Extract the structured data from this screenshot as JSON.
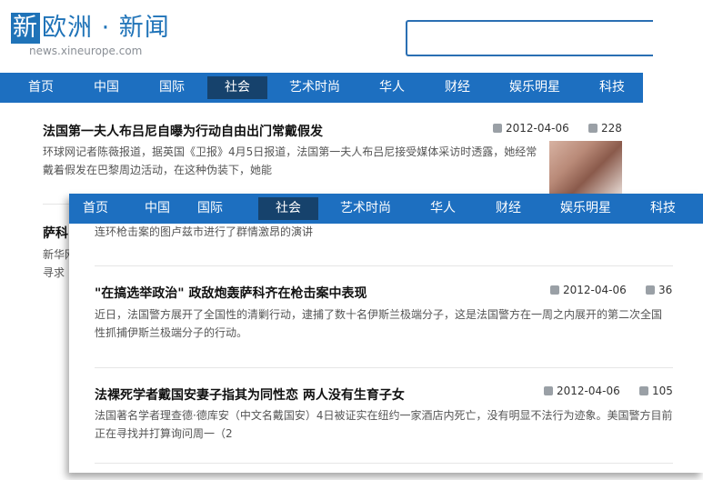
{
  "logo": {
    "box_char": "新",
    "rest": "欧洲",
    "dot": "·",
    "news": "新闻",
    "url": "news.xineurope.com"
  },
  "nav": [
    {
      "label": "首页"
    },
    {
      "label": "中国"
    },
    {
      "label": "国际"
    },
    {
      "label": "社会",
      "active": true
    },
    {
      "label": "艺术时尚"
    },
    {
      "label": "华人"
    },
    {
      "label": "财经"
    },
    {
      "label": "娱乐明星"
    },
    {
      "label": "科技"
    }
  ],
  "article1": {
    "title": "法国第一夫人布吕尼自曝为行动自由出门常戴假发",
    "date": "2012-04-06",
    "comments": "228",
    "summary_l1": "环球网记者陈薇报道，据英国《卫报》4月5日报道，法国第一夫人布吕尼接受媒体采访时透露，她经常",
    "summary_l2": "戴着假发在巴黎周边活动，在这种伪装下，她能"
  },
  "bg_edge": {
    "title": "萨科",
    "l1": "新华网",
    "l2": "寻求"
  },
  "panel": {
    "partial": "连环枪击案的图卢兹市进行了群情激昂的演讲",
    "article2": {
      "title": "\"在搞选举政治\" 政敌炮轰萨科齐在枪击案中表现",
      "date": "2012-04-06",
      "comments": "36",
      "summary_l1": "近日，法国警方展开了全国性的清剿行动，逮捕了数十名伊斯兰极端分子，这是法国警方在一周之内展开的第二次全国",
      "summary_l2": "性抓捕伊斯兰极端分子的行动。"
    },
    "article3": {
      "title": "法裸死学者戴国安妻子指其为同性恋 两人没有生育子女",
      "date": "2012-04-06",
      "comments": "105",
      "summary_l1": "法国著名学者理查德·德库安（中文名戴国安）4日被证实在纽约一家酒店内死亡，没有明显不法行为迹象。美国警方目前",
      "summary_l2": "正在寻找并打算询问周一（2"
    }
  },
  "colors": {
    "nav_bg": "#1d6fc0",
    "nav_active": "#16426c",
    "brand": "#1f73b8"
  }
}
